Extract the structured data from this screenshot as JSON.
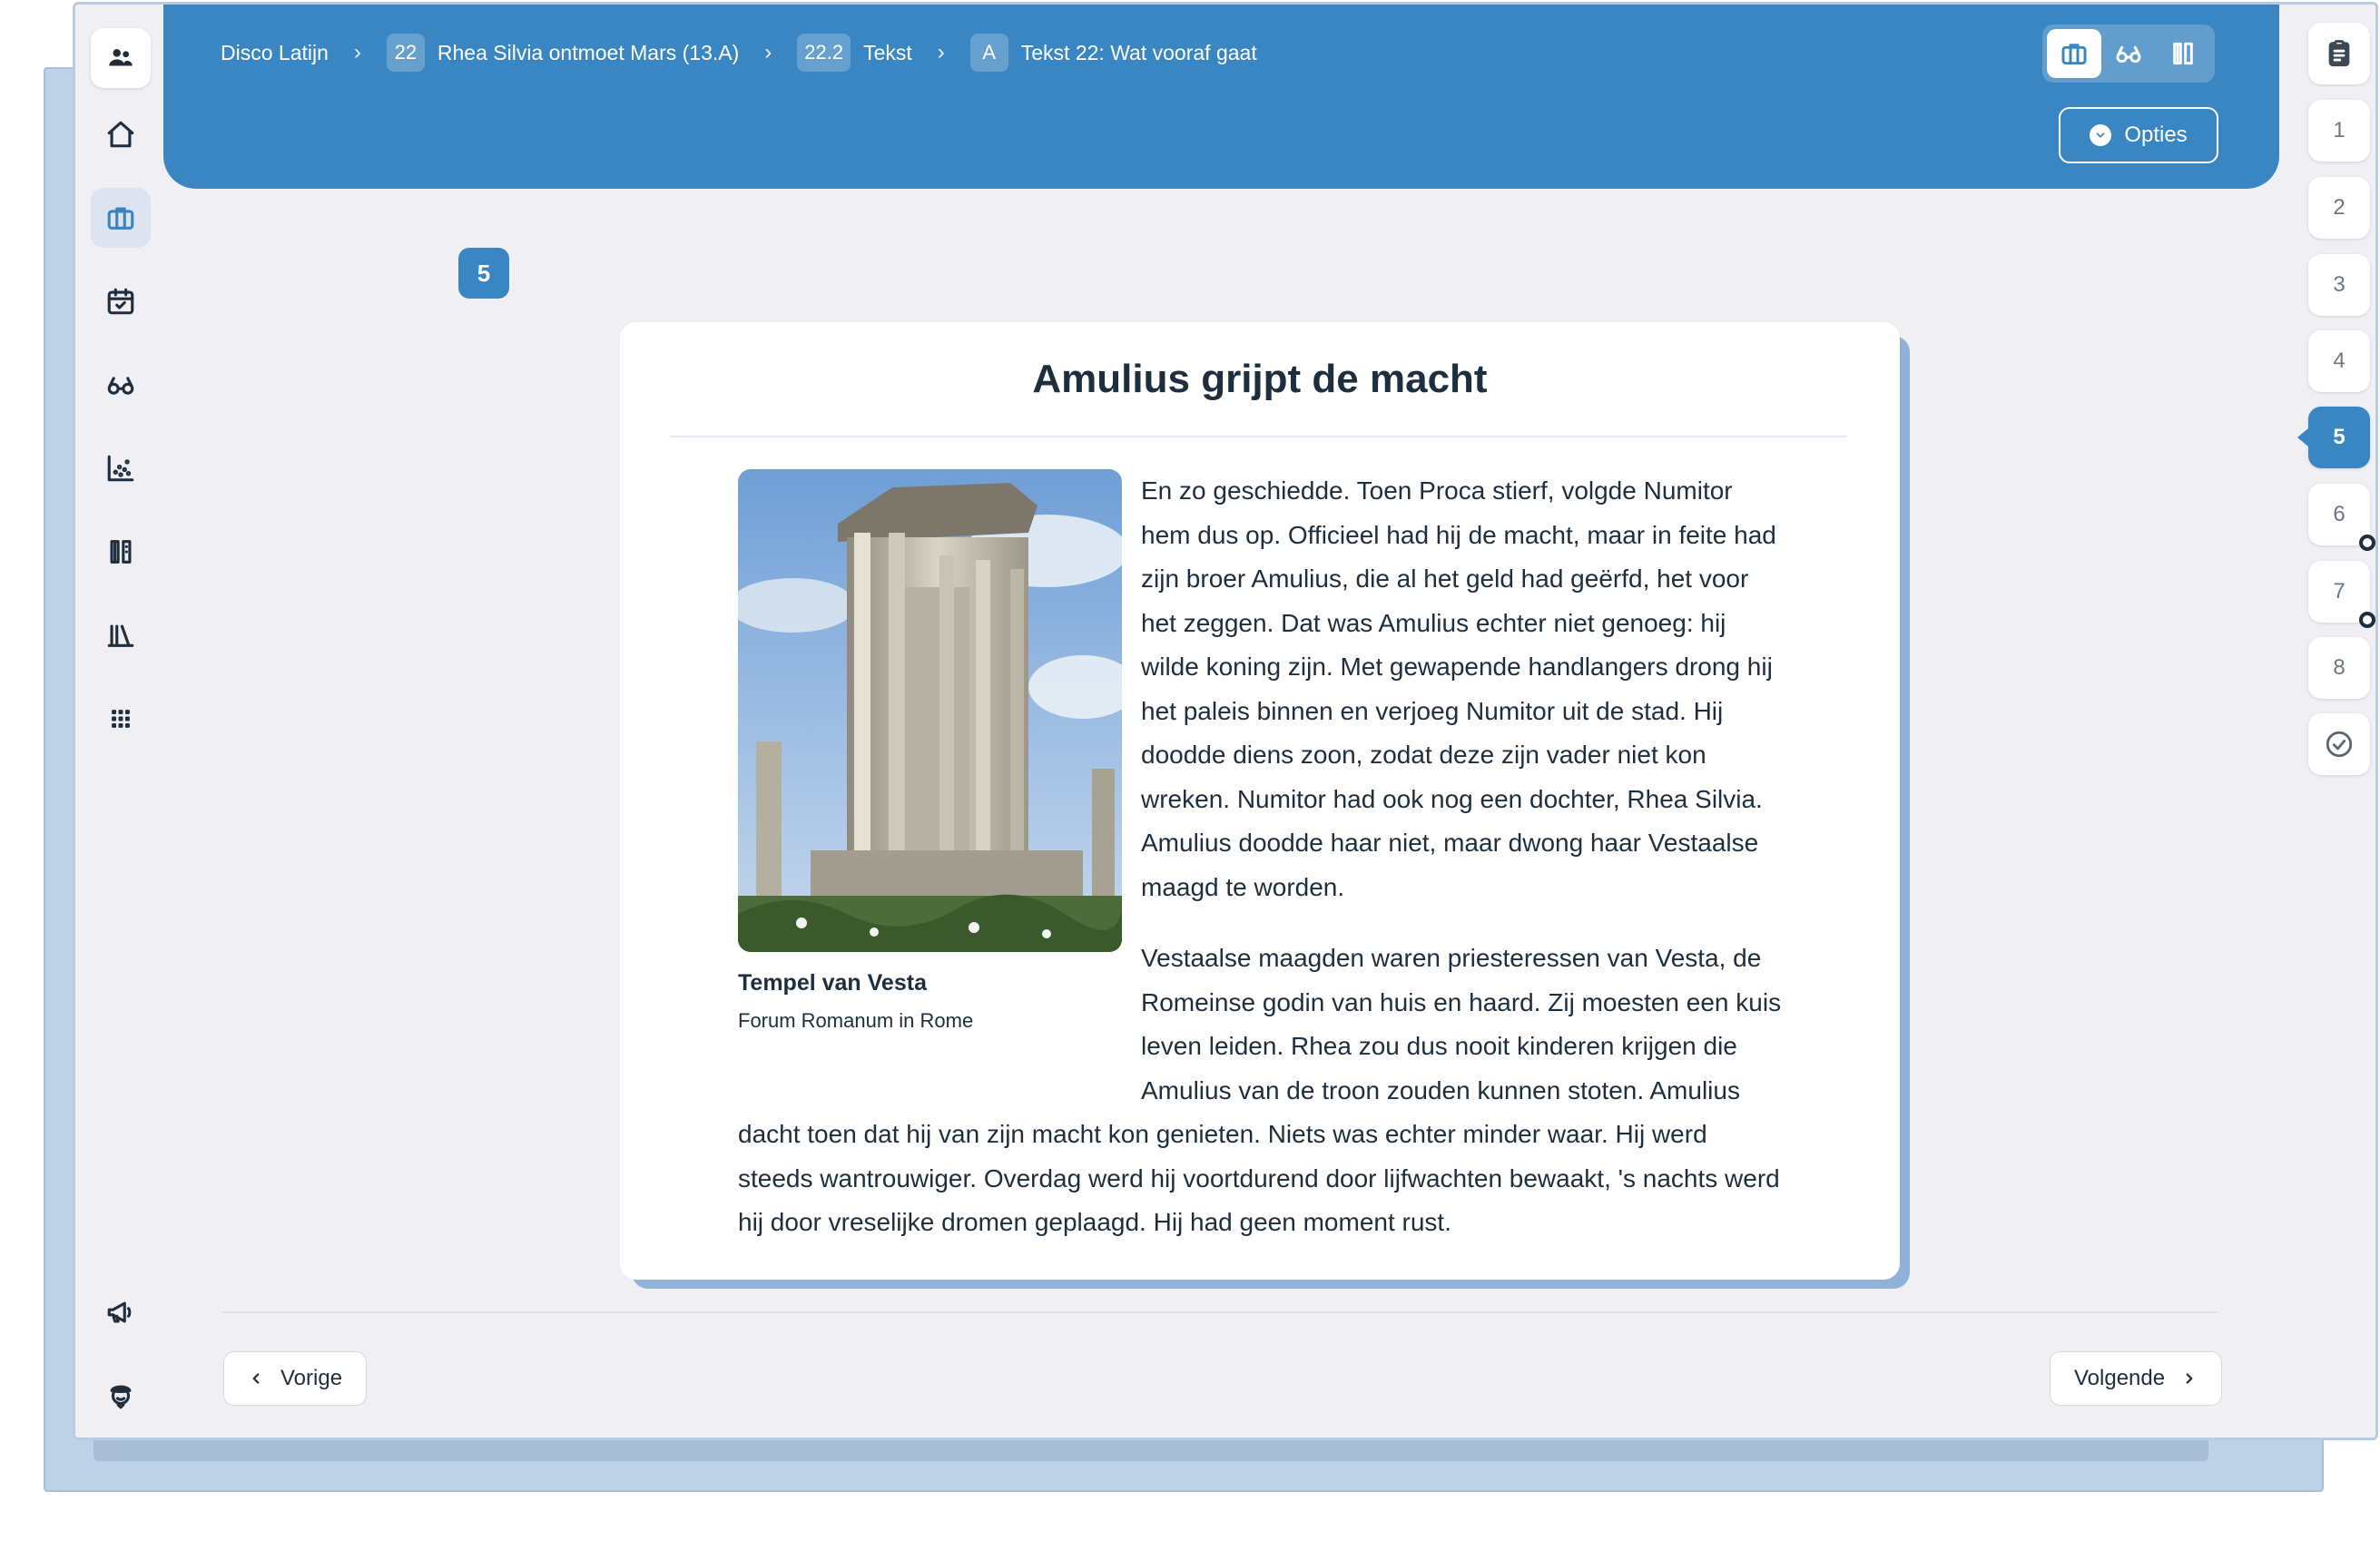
{
  "breadcrumb": {
    "course": "Disco Latijn",
    "chapter_num": "22",
    "chapter_title": "Rhea Silvia ontmoet Mars (13.A)",
    "section_num": "22.2",
    "section_title": "Tekst",
    "part_letter": "A",
    "part_title": "Tekst 22: Wat vooraf gaat"
  },
  "header": {
    "options_label": "Opties",
    "view_modes": [
      "briefcase-icon",
      "glasses-icon",
      "book-columns-icon"
    ],
    "active_mode": "briefcase-icon"
  },
  "page_badge": "5",
  "steps": {
    "items": [
      "1",
      "2",
      "3",
      "4",
      "5",
      "6",
      "7",
      "8"
    ],
    "active": "5"
  },
  "article": {
    "title": "Amulius grijpt de macht",
    "image_caption": "Tempel van Vesta",
    "image_subcaption": "Forum Romanum in Rome",
    "paragraphs": [
      "En zo geschiedde. Toen Proca stierf, volgde Numitor hem dus op. Officieel had hij de macht, maar in feite had zijn broer Amulius, die al het geld had geërfd, het voor het zeggen. Dat was Amulius echter niet genoeg: hij wilde koning zijn. Met gewapende handlangers drong hij het paleis binnen en verjoeg Numitor uit de stad. Hij doodde diens zoon, zodat deze zijn vader niet kon wreken. Numitor had ook nog een dochter, Rhea Silvia. Amulius doodde haar niet, maar dwong haar Vestaalse maagd te worden.",
      "Vestaalse maagden waren priesteressen van Vesta, de Romeinse godin van huis en haard. Zij moesten een kuis leven leiden. Rhea zou dus nooit kinderen krijgen die Amulius van de troon zouden kunnen stoten. Amulius dacht toen dat hij van zijn macht kon genieten. Niets was echter minder waar. Hij werd steeds wantrouwiger. Overdag werd hij voortdurend door lijfwachten bewaakt, 's nachts werd hij door vreselijke dromen geplaagd. Hij had geen moment rust."
    ]
  },
  "navigation": {
    "prev_label": "Vorige",
    "next_label": "Volgende"
  },
  "colors": {
    "accent": "#3a86c2",
    "background": "#efeff4",
    "text": "#1d2f3f"
  }
}
